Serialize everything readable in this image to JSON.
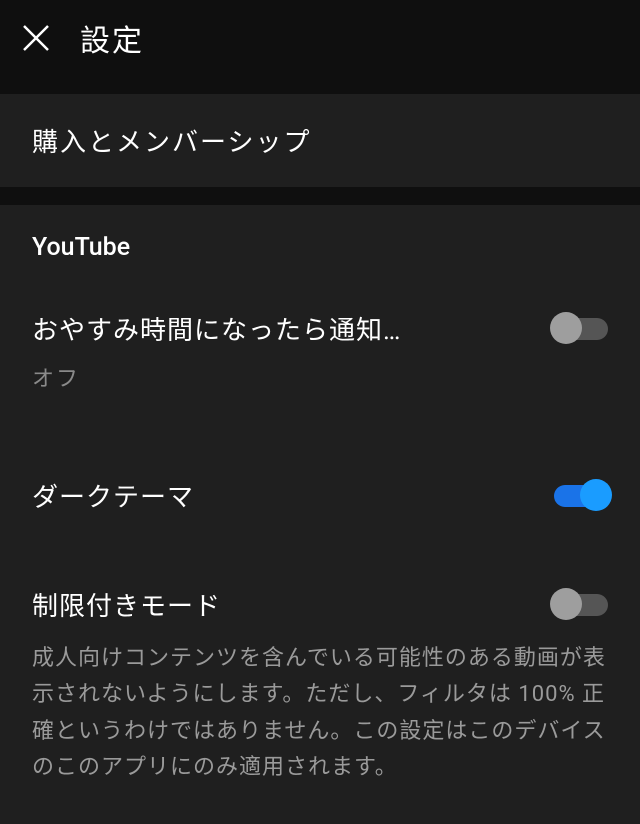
{
  "header": {
    "title": "設定"
  },
  "sections": {
    "purchases": {
      "label": "購入とメンバーシップ"
    },
    "youtube": {
      "header": "YouTube",
      "items": {
        "bedtime": {
          "title": "おやすみ時間になったら通知…",
          "sub": "オフ",
          "toggle": false
        },
        "darktheme": {
          "title": "ダークテーマ",
          "toggle": true
        },
        "restricted": {
          "title": "制限付きモード",
          "description": "成人向けコンテンツを含んでいる可能性のある動画が表示されないようにします。ただし、フィルタは 100% 正確というわけではありません。この設定はこのデバイスのこのアプリにのみ適用されます。",
          "toggle": false
        }
      }
    }
  }
}
